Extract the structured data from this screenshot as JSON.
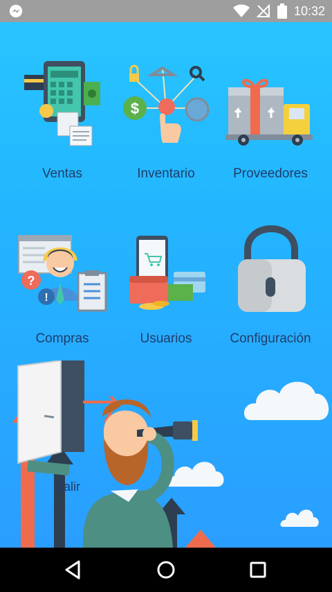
{
  "status_bar": {
    "time": "10:32",
    "icons": [
      "messenger-icon",
      "wifi-icon",
      "no-signal-icon",
      "battery-icon"
    ]
  },
  "menu": {
    "items": [
      {
        "label": "Ventas",
        "icon": "sales-icon"
      },
      {
        "label": "Inventario",
        "icon": "inventory-icon"
      },
      {
        "label": "Proveedores",
        "icon": "suppliers-truck-icon"
      },
      {
        "label": "Compras",
        "icon": "purchases-icon"
      },
      {
        "label": "Usuarios",
        "icon": "users-wallet-icon"
      },
      {
        "label": "Configuración",
        "icon": "padlock-icon"
      },
      {
        "label": "Salir",
        "icon": "exit-door-icon"
      }
    ]
  },
  "nav": {
    "back": "back-icon",
    "home": "home-icon",
    "recents": "recents-icon"
  },
  "colors": {
    "background_top": "#28c4ff",
    "background_bottom": "#2a9eff",
    "label_text": "#1f3d6b",
    "status_bar": "#9e9e9e",
    "nav_bar": "#000000"
  }
}
